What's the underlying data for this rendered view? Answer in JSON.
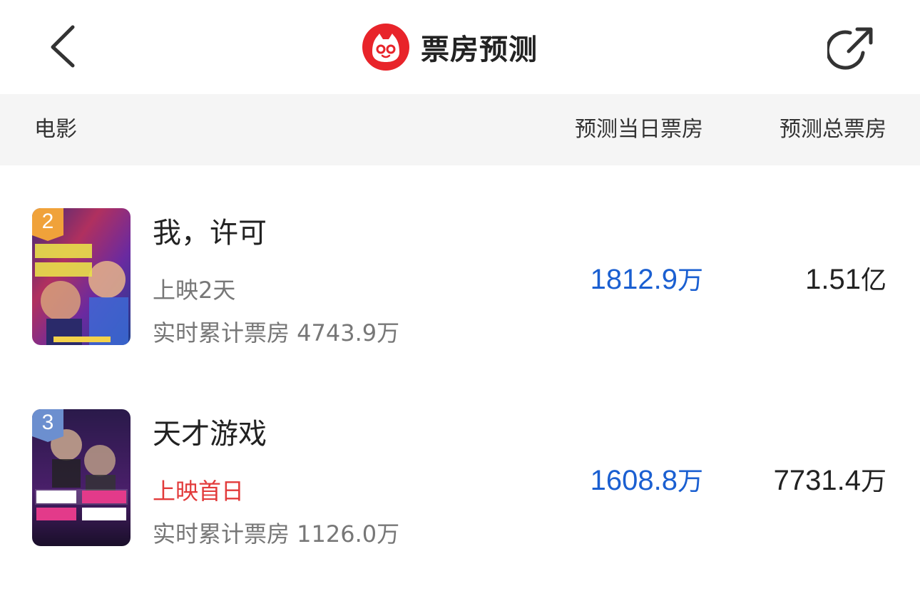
{
  "header": {
    "title": "票房预测",
    "back_icon": "chevron-left-icon",
    "share_icon": "share-icon",
    "brand_color": "#e8242a"
  },
  "columns": {
    "movie": "电影",
    "daily_forecast": "预测当日票房",
    "total_forecast": "预测总票房"
  },
  "movies": [
    {
      "rank": "2",
      "rank_color": "#f0a23a",
      "title": "我，许可",
      "release_status": "上映2天",
      "cumulative_label": "实时累计票房 4743.9万",
      "daily_value": "1812.9",
      "daily_unit": "万",
      "total_value": "1.51",
      "total_unit": "亿"
    },
    {
      "rank": "3",
      "rank_color": "#6c8fcf",
      "title": "天才游戏",
      "release_status": "上映首日",
      "release_status_color": "#e23b3b",
      "cumulative_label": "实时累计票房 1126.0万",
      "daily_value": "1608.8",
      "daily_unit": "万",
      "total_value": "7731.4",
      "total_unit": "万"
    }
  ]
}
